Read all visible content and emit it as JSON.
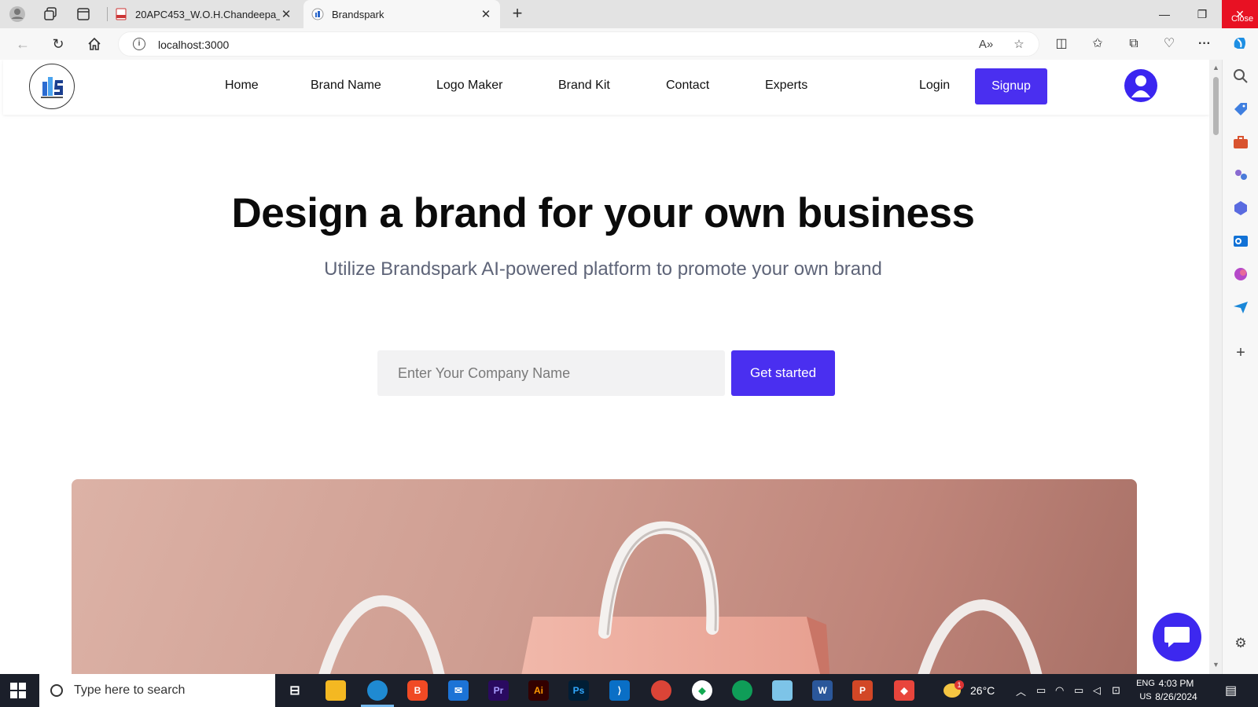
{
  "browser": {
    "tabs": [
      {
        "title": "20APC453_W.O.H.Chandeepa_Pro"
      },
      {
        "title": "Brandspark"
      }
    ],
    "url": "localhost:3000",
    "close_label": "Close"
  },
  "site": {
    "nav": [
      "Home",
      "Brand Name",
      "Logo Maker",
      "Brand Kit",
      "Contact",
      "Experts"
    ],
    "login_label": "Login",
    "signup_label": "Signup",
    "hero_title": "Design a brand for your own business",
    "hero_subtitle": "Utilize Brandspark AI-powered platform to promote your own brand",
    "company_placeholder": "Enter Your Company Name",
    "cta_label": "Get started",
    "accent_color": "#4a2ff0"
  },
  "taskbar": {
    "search_placeholder": "Type here to search",
    "weather": "26°C",
    "lang_line1": "ENG",
    "lang_line2": "US",
    "time": "4:03 PM",
    "date": "8/26/2024",
    "weather_badge": "1"
  }
}
